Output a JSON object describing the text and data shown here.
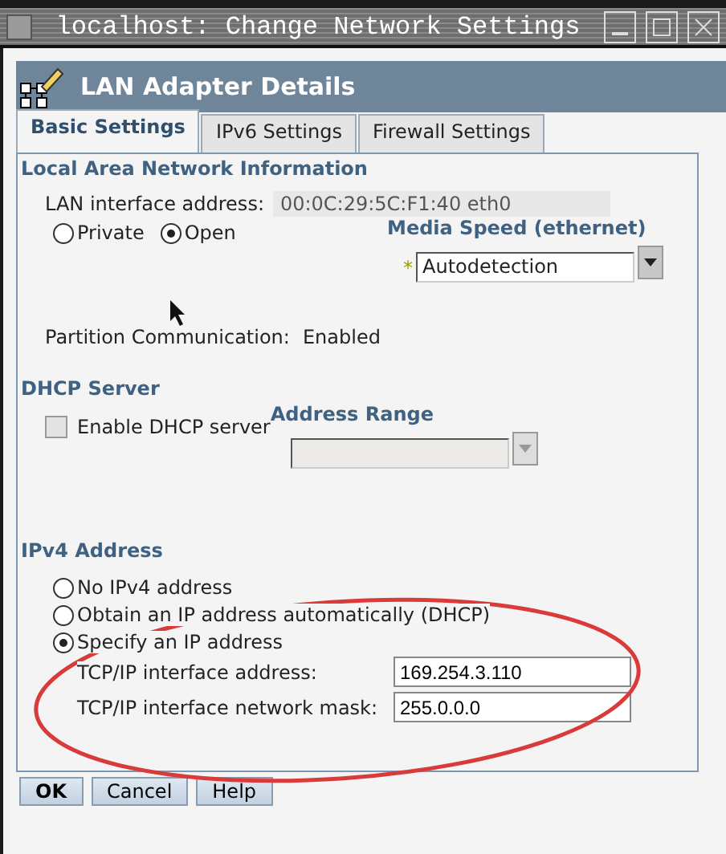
{
  "window": {
    "title": "localhost: Change Network Settings"
  },
  "header": {
    "title": "LAN Adapter Details"
  },
  "tabs": [
    {
      "label": "Basic Settings",
      "selected": true
    },
    {
      "label": "IPv6 Settings",
      "selected": false
    },
    {
      "label": "Firewall Settings",
      "selected": false
    }
  ],
  "lan": {
    "heading": "Local Area Network Information",
    "address_label": "LAN interface address:",
    "address_value": "00:0C:29:5C:F1:40 eth0",
    "access": [
      {
        "label": "Private",
        "selected": false
      },
      {
        "label": "Open",
        "selected": true
      }
    ],
    "media_speed": {
      "heading": "Media Speed (ethernet)",
      "required_mark": "*",
      "value": "Autodetection"
    },
    "partition_label": "Partition Communication:",
    "partition_value": "Enabled"
  },
  "dhcp": {
    "heading": "DHCP Server",
    "enable": {
      "label": "Enable DHCP server",
      "checked": false
    },
    "range": {
      "heading": "Address Range",
      "disabled": true
    }
  },
  "ipv4": {
    "heading": "IPv4 Address",
    "options": [
      {
        "label": "No IPv4 address",
        "selected": false
      },
      {
        "label": "Obtain an IP address automatically (DHCP)",
        "selected": false
      },
      {
        "label": "Specify an IP address",
        "selected": true
      }
    ],
    "fields": [
      {
        "label": "TCP/IP interface address:",
        "value": "169.254.3.110"
      },
      {
        "label": "TCP/IP interface network mask:",
        "value": "255.0.0.0"
      }
    ]
  },
  "buttons": [
    "OK",
    "Cancel",
    "Help"
  ],
  "annotation": {
    "kind": "ellipse"
  }
}
